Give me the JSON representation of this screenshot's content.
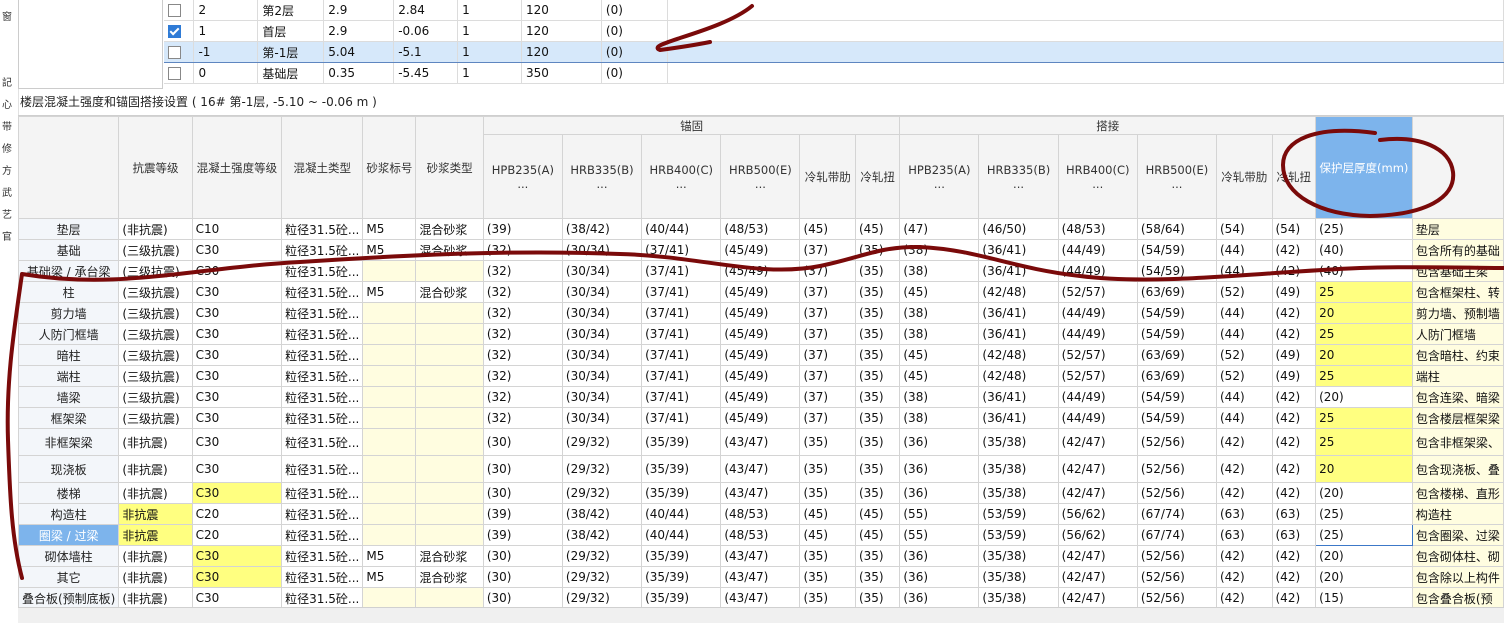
{
  "left_strip_chars": [
    "窗",
    "",
    "",
    "記",
    "心",
    "带",
    "修",
    "方",
    "武",
    "艺",
    "官"
  ],
  "floor_rows": [
    {
      "checked": false,
      "code": "2",
      "name": "第2层",
      "height": "2.9",
      "elevation": "2.84",
      "count": "1",
      "thickness": "120",
      "extra": "(0)"
    },
    {
      "checked": true,
      "code": "1",
      "name": "首层",
      "height": "2.9",
      "elevation": "-0.06",
      "count": "1",
      "thickness": "120",
      "extra": "(0)"
    },
    {
      "checked": false,
      "code": "-1",
      "name": "第-1层",
      "height": "5.04",
      "elevation": "-5.1",
      "count": "1",
      "thickness": "120",
      "extra": "(0)",
      "selected": true
    },
    {
      "checked": false,
      "code": "0",
      "name": "基础层",
      "height": "0.35",
      "elevation": "-5.45",
      "count": "1",
      "thickness": "350",
      "extra": "(0)"
    }
  ],
  "section_title": "楼层混凝土强度和锚固搭接设置 ( 16#  第-1层, -5.10 ~ -0.06 m )",
  "header": {
    "seismic": "抗震等级",
    "concrete_grade": "混凝土强度等级",
    "concrete_type": "混凝土类型",
    "mortar_grade": "砂浆标号",
    "mortar_type": "砂浆类型",
    "anchor_group": "锚固",
    "lap_group": "搭接",
    "anchor_cols": [
      "HPB235(A)",
      "HRB335(B)",
      "HRB400(C)",
      "HRB500(E)",
      "冷轧带肋",
      "冷轧扭"
    ],
    "lap_cols": [
      "HPB235(A)",
      "HRB335(B)",
      "HRB400(C)",
      "HRB500(E)",
      "冷轧带肋",
      "冷轧扭"
    ],
    "ellipsis": "...",
    "cover": "保护层厚度(mm)"
  },
  "rows": [
    {
      "name": "垫层",
      "seismic": "(非抗震)",
      "grade": "C10",
      "ctype": "粒径31.5砼...",
      "mgrade": "M5",
      "mtype": "混合砂浆",
      "anchor": [
        "(39)",
        "(38/42)",
        "(40/44)",
        "(48/53)",
        "(45)",
        "(45)"
      ],
      "lap": [
        "(47)",
        "(46/50)",
        "(48/53)",
        "(58/64)",
        "(54)",
        "(54)"
      ],
      "cover": "(25)",
      "note": "垫层"
    },
    {
      "name": "基础",
      "seismic": "(三级抗震)",
      "grade": "C30",
      "ctype": "粒径31.5砼...",
      "mgrade": "M5",
      "mtype": "混合砂浆",
      "anchor": [
        "(32)",
        "(30/34)",
        "(37/41)",
        "(45/49)",
        "(37)",
        "(35)"
      ],
      "lap": [
        "(38)",
        "(36/41)",
        "(44/49)",
        "(54/59)",
        "(44)",
        "(42)"
      ],
      "cover": "(40)",
      "note": "包含所有的基础"
    },
    {
      "name": "基础梁 / 承台梁",
      "seismic": "(三级抗震)",
      "grade": "C30",
      "ctype": "粒径31.5砼...",
      "mgrade": "",
      "mtype": "",
      "anchor": [
        "(32)",
        "(30/34)",
        "(37/41)",
        "(45/49)",
        "(37)",
        "(35)"
      ],
      "lap": [
        "(38)",
        "(36/41)",
        "(44/49)",
        "(54/59)",
        "(44)",
        "(42)"
      ],
      "cover": "(40)",
      "note": "包含基础主梁"
    },
    {
      "name": "柱",
      "seismic": "(三级抗震)",
      "grade": "C30",
      "ctype": "粒径31.5砼...",
      "mgrade": "M5",
      "mtype": "混合砂浆",
      "anchor": [
        "(32)",
        "(30/34)",
        "(37/41)",
        "(45/49)",
        "(37)",
        "(35)"
      ],
      "lap": [
        "(45)",
        "(42/48)",
        "(52/57)",
        "(63/69)",
        "(52)",
        "(49)"
      ],
      "cover": "25",
      "note": "包含框架柱、转"
    },
    {
      "name": "剪力墙",
      "seismic": "(三级抗震)",
      "grade": "C30",
      "ctype": "粒径31.5砼...",
      "mgrade": "",
      "mtype": "",
      "anchor": [
        "(32)",
        "(30/34)",
        "(37/41)",
        "(45/49)",
        "(37)",
        "(35)"
      ],
      "lap": [
        "(38)",
        "(36/41)",
        "(44/49)",
        "(54/59)",
        "(44)",
        "(42)"
      ],
      "cover": "20",
      "note": "剪力墙、预制墙"
    },
    {
      "name": "人防门框墙",
      "seismic": "(三级抗震)",
      "grade": "C30",
      "ctype": "粒径31.5砼...",
      "mgrade": "",
      "mtype": "",
      "anchor": [
        "(32)",
        "(30/34)",
        "(37/41)",
        "(45/49)",
        "(37)",
        "(35)"
      ],
      "lap": [
        "(38)",
        "(36/41)",
        "(44/49)",
        "(54/59)",
        "(44)",
        "(42)"
      ],
      "cover": "25",
      "note": "人防门框墙"
    },
    {
      "name": "暗柱",
      "seismic": "(三级抗震)",
      "grade": "C30",
      "ctype": "粒径31.5砼...",
      "mgrade": "",
      "mtype": "",
      "anchor": [
        "(32)",
        "(30/34)",
        "(37/41)",
        "(45/49)",
        "(37)",
        "(35)"
      ],
      "lap": [
        "(45)",
        "(42/48)",
        "(52/57)",
        "(63/69)",
        "(52)",
        "(49)"
      ],
      "cover": "20",
      "note": "包含暗柱、约束"
    },
    {
      "name": "端柱",
      "seismic": "(三级抗震)",
      "grade": "C30",
      "ctype": "粒径31.5砼...",
      "mgrade": "",
      "mtype": "",
      "anchor": [
        "(32)",
        "(30/34)",
        "(37/41)",
        "(45/49)",
        "(37)",
        "(35)"
      ],
      "lap": [
        "(45)",
        "(42/48)",
        "(52/57)",
        "(63/69)",
        "(52)",
        "(49)"
      ],
      "cover": "25",
      "note": "端柱"
    },
    {
      "name": "墙梁",
      "seismic": "(三级抗震)",
      "grade": "C30",
      "ctype": "粒径31.5砼...",
      "mgrade": "",
      "mtype": "",
      "anchor": [
        "(32)",
        "(30/34)",
        "(37/41)",
        "(45/49)",
        "(37)",
        "(35)"
      ],
      "lap": [
        "(38)",
        "(36/41)",
        "(44/49)",
        "(54/59)",
        "(44)",
        "(42)"
      ],
      "cover": "(20)",
      "note": "包含连梁、暗梁"
    },
    {
      "name": "框架梁",
      "seismic": "(三级抗震)",
      "grade": "C30",
      "ctype": "粒径31.5砼...",
      "mgrade": "",
      "mtype": "",
      "anchor": [
        "(32)",
        "(30/34)",
        "(37/41)",
        "(45/49)",
        "(37)",
        "(35)"
      ],
      "lap": [
        "(38)",
        "(36/41)",
        "(44/49)",
        "(54/59)",
        "(44)",
        "(42)"
      ],
      "cover": "25",
      "note": "包含楼层框架梁"
    },
    {
      "name": "非框架梁",
      "seismic": "(非抗震)",
      "grade": "C30",
      "ctype": "粒径31.5砼...",
      "mgrade": "",
      "mtype": "",
      "anchor": [
        "(30)",
        "(29/32)",
        "(35/39)",
        "(43/47)",
        "(35)",
        "(35)"
      ],
      "lap": [
        "(36)",
        "(35/38)",
        "(42/47)",
        "(52/56)",
        "(42)",
        "(42)"
      ],
      "cover": "25",
      "note": "包含非框架梁、"
    },
    {
      "name": "现浇板",
      "seismic": "(非抗震)",
      "grade": "C30",
      "ctype": "粒径31.5砼...",
      "mgrade": "",
      "mtype": "",
      "anchor": [
        "(30)",
        "(29/32)",
        "(35/39)",
        "(43/47)",
        "(35)",
        "(35)"
      ],
      "lap": [
        "(36)",
        "(35/38)",
        "(42/47)",
        "(52/56)",
        "(42)",
        "(42)"
      ],
      "cover": "20",
      "note": "包含现浇板、叠"
    },
    {
      "name": "楼梯",
      "seismic": "(非抗震)",
      "grade": "C30",
      "ctype": "粒径31.5砼...",
      "mgrade": "",
      "mtype": "",
      "anchor": [
        "(30)",
        "(29/32)",
        "(35/39)",
        "(43/47)",
        "(35)",
        "(35)"
      ],
      "lap": [
        "(36)",
        "(35/38)",
        "(42/47)",
        "(52/56)",
        "(42)",
        "(42)"
      ],
      "cover": "(20)",
      "note": "包含楼梯、直形"
    },
    {
      "name": "构造柱",
      "seismic": "非抗震",
      "grade": "C20",
      "ctype": "粒径31.5砼...",
      "mgrade": "",
      "mtype": "",
      "anchor": [
        "(39)",
        "(38/42)",
        "(40/44)",
        "(48/53)",
        "(45)",
        "(45)"
      ],
      "lap": [
        "(55)",
        "(53/59)",
        "(56/62)",
        "(67/74)",
        "(63)",
        "(63)"
      ],
      "cover": "(25)",
      "note": "构造柱"
    },
    {
      "name": "圈梁 / 过梁",
      "seismic": "非抗震",
      "grade": "C20",
      "ctype": "粒径31.5砼...",
      "mgrade": "",
      "mtype": "",
      "anchor": [
        "(39)",
        "(38/42)",
        "(40/44)",
        "(48/53)",
        "(45)",
        "(45)"
      ],
      "lap": [
        "(55)",
        "(53/59)",
        "(56/62)",
        "(67/74)",
        "(63)",
        "(63)"
      ],
      "cover": "(25)",
      "note": "包含圈梁、过梁"
    },
    {
      "name": "砌体墙柱",
      "seismic": "(非抗震)",
      "grade": "C30",
      "ctype": "粒径31.5砼...",
      "mgrade": "M5",
      "mtype": "混合砂浆",
      "anchor": [
        "(30)",
        "(29/32)",
        "(35/39)",
        "(43/47)",
        "(35)",
        "(35)"
      ],
      "lap": [
        "(36)",
        "(35/38)",
        "(42/47)",
        "(52/56)",
        "(42)",
        "(42)"
      ],
      "cover": "(20)",
      "note": "包含砌体柱、砌"
    },
    {
      "name": "其它",
      "seismic": "(非抗震)",
      "grade": "C30",
      "ctype": "粒径31.5砼...",
      "mgrade": "M5",
      "mtype": "混合砂浆",
      "anchor": [
        "(30)",
        "(29/32)",
        "(35/39)",
        "(43/47)",
        "(35)",
        "(35)"
      ],
      "lap": [
        "(36)",
        "(35/38)",
        "(42/47)",
        "(52/56)",
        "(42)",
        "(42)"
      ],
      "cover": "(20)",
      "note": "包含除以上构件"
    },
    {
      "name": "叠合板(预制底板)",
      "seismic": "(非抗震)",
      "grade": "C30",
      "ctype": "粒径31.5砼...",
      "mgrade": "",
      "mtype": "",
      "anchor": [
        "(30)",
        "(29/32)",
        "(35/39)",
        "(43/47)",
        "(35)",
        "(35)"
      ],
      "lap": [
        "(36)",
        "(35/38)",
        "(42/47)",
        "(52/56)",
        "(42)",
        "(42)"
      ],
      "cover": "(15)",
      "note": "包含叠合板(预"
    }
  ],
  "colors": {
    "cover_highlight": "#ffff80",
    "selected_row": "#d6e8fa",
    "header_highlight": "#7db4ec",
    "annotation": "#7a0a0a"
  }
}
